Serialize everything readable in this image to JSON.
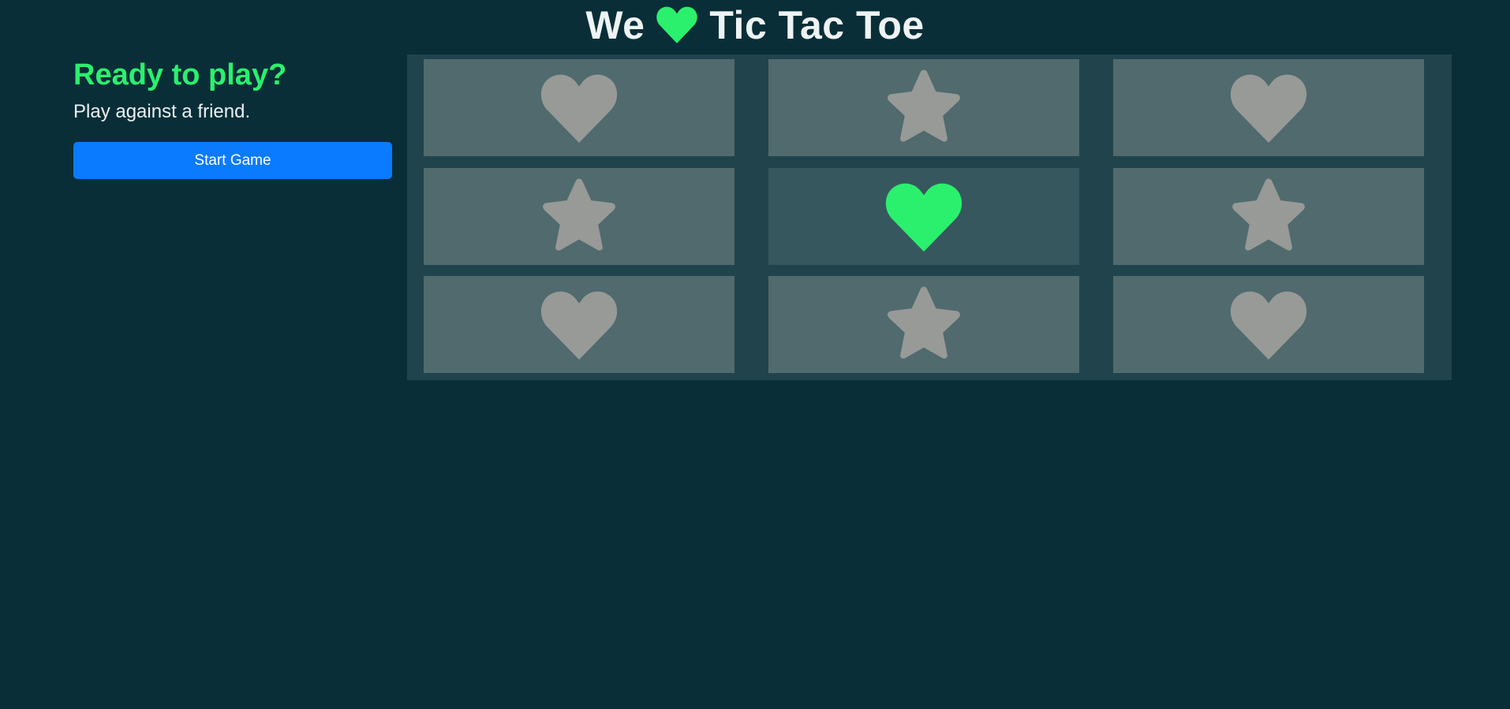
{
  "header": {
    "title_before": "We",
    "title_icon": "heart-icon",
    "title_after": "Tic Tac Toe"
  },
  "sidebar": {
    "headline": "Ready to play?",
    "subtitle": "Play against a friend.",
    "start_button_label": "Start Game"
  },
  "colors": {
    "background": "#092e38",
    "accent_green": "#2bf06d",
    "button_blue": "#0a7bff",
    "board_bg": "#21444c",
    "cell_bg": "#506a6e",
    "cell_highlight_bg": "#37575f",
    "piece_gray": "#979a96"
  },
  "board": {
    "cells": [
      {
        "piece": "heart",
        "highlight": false
      },
      {
        "piece": "star",
        "highlight": false
      },
      {
        "piece": "heart",
        "highlight": false
      },
      {
        "piece": "star",
        "highlight": false
      },
      {
        "piece": "heart",
        "highlight": true
      },
      {
        "piece": "star",
        "highlight": false
      },
      {
        "piece": "heart",
        "highlight": false
      },
      {
        "piece": "star",
        "highlight": false
      },
      {
        "piece": "heart",
        "highlight": false
      }
    ]
  }
}
